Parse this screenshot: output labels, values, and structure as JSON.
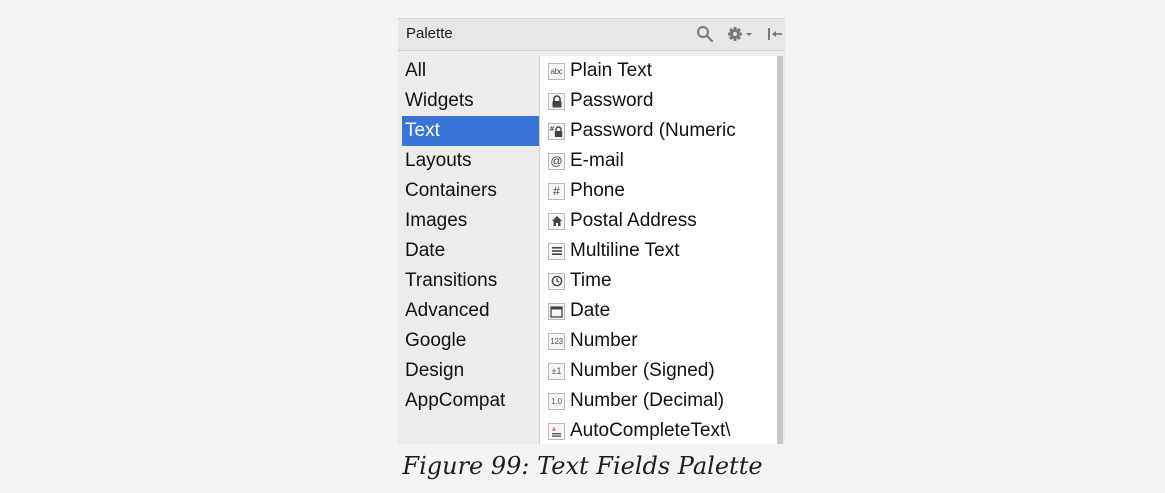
{
  "palette": {
    "title": "Palette",
    "header_icons": [
      "search-icon",
      "gear-icon",
      "hide-panel-icon"
    ]
  },
  "categories": [
    {
      "label": "All",
      "selected": false
    },
    {
      "label": "Widgets",
      "selected": false
    },
    {
      "label": "Text",
      "selected": true
    },
    {
      "label": "Layouts",
      "selected": false
    },
    {
      "label": "Containers",
      "selected": false
    },
    {
      "label": "Images",
      "selected": false
    },
    {
      "label": "Date",
      "selected": false
    },
    {
      "label": "Transitions",
      "selected": false
    },
    {
      "label": "Advanced",
      "selected": false
    },
    {
      "label": "Google",
      "selected": false
    },
    {
      "label": "Design",
      "selected": false
    },
    {
      "label": "AppCompat",
      "selected": false
    }
  ],
  "widgets": [
    {
      "label": "Plain Text",
      "icon": "abc-text-icon",
      "glyph": "abc"
    },
    {
      "label": "Password",
      "icon": "lock-icon",
      "glyph": "🔒"
    },
    {
      "label": "Password (Numeric",
      "icon": "numeric-lock-icon",
      "glyph": "#🔒"
    },
    {
      "label": "E-mail",
      "icon": "at-sign-icon",
      "glyph": "@"
    },
    {
      "label": "Phone",
      "icon": "hash-icon",
      "glyph": "#"
    },
    {
      "label": "Postal Address",
      "icon": "home-icon",
      "glyph": "⌂"
    },
    {
      "label": "Multiline Text",
      "icon": "multiline-icon",
      "glyph": "≡"
    },
    {
      "label": "Time",
      "icon": "clock-icon",
      "glyph": "◷"
    },
    {
      "label": "Date",
      "icon": "calendar-icon",
      "glyph": "2"
    },
    {
      "label": "Number",
      "icon": "number-icon",
      "glyph": "123"
    },
    {
      "label": "Number (Signed)",
      "icon": "signed-number-icon",
      "glyph": "±1"
    },
    {
      "label": "Number (Decimal)",
      "icon": "decimal-number-icon",
      "glyph": "1.0"
    },
    {
      "label": "AutoCompleteText\\",
      "icon": "autocomplete-icon",
      "glyph": "a"
    }
  ],
  "caption": "Figure 99: Text Fields Palette"
}
